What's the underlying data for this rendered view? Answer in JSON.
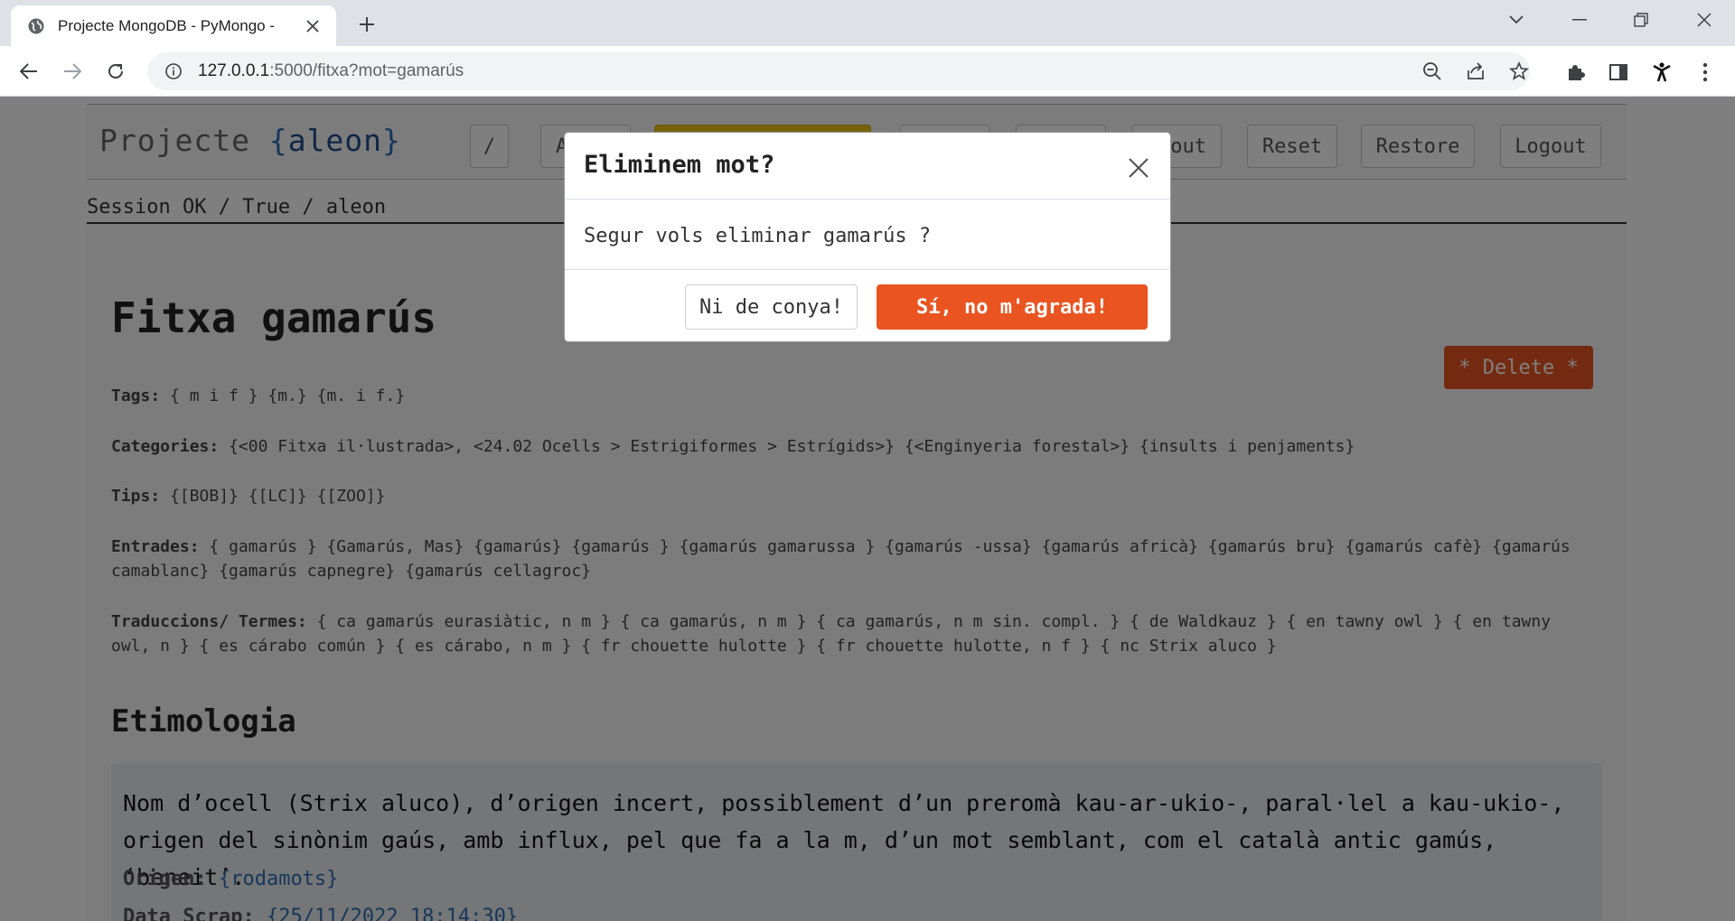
{
  "browser": {
    "tab_title": "Projecte MongoDB - PyMongo -",
    "url_host": "127.0.0.1",
    "url_path": ":5000/fitxa?mot=gamarús"
  },
  "navbar": {
    "brand_prefix": "Projecte ",
    "brand_open": "{",
    "brand_name": "aleon",
    "brand_close": "}",
    "buttons": [
      {
        "label": "/"
      },
      {
        "label": "A"
      },
      {
        "label": ""
      },
      {
        "label": ""
      },
      {
        "label": ""
      },
      {
        "label": "out"
      },
      {
        "label": "Reset"
      },
      {
        "label": "Restore"
      },
      {
        "label": "Logout"
      }
    ]
  },
  "session_text": "Session OK / True / aleon",
  "delete_label": "* Delete *",
  "title": "Fitxa gamarús",
  "fields": {
    "tags_label": "Tags:",
    "tags": [
      "{ m i f }",
      "{m.}",
      "{m. i f.}"
    ],
    "categories_label": "Categories:",
    "categories": [
      "{<00 Fitxa il·lustrada>, <24.02 Ocells > Estrigiformes > Estrígids>}",
      "{<Enginyeria forestal>}",
      "{insults i penjaments}"
    ],
    "tips_label": "Tips:",
    "tips": [
      "{[BOB]}",
      "{[LC]}",
      "{[ZOO]}"
    ],
    "entrades_label": "Entrades:",
    "entrades": "{ gamarús } {Gamarús, Mas} {gamarús} {gamarús } {gamarús  gamarussa } {gamarús -ussa} {gamarús africà} {gamarús bru} {gamarús cafè} {gamarús camablanc} {gamarús capnegre} {gamarús cellagroc}",
    "traduccions_label": "Traduccions/ Termes:",
    "traduccions": "{ ca  gamarús eurasiàtic, n m } { ca  gamarús, n m } { ca  gamarús, n m sin. compl. } { de  Waldkauz } { en  tawny owl } { en  tawny owl, n } { es  cárabo común } { es  cárabo, n m } { fr  chouette hulotte } { fr  chouette hulotte, n f } { nc  Strix aluco }"
  },
  "etimologia": {
    "heading": "Etimologia",
    "text": "Nom d’ocell (Strix aluco), d’origen incert, possiblement d’un preromà kau-ar-ukio-, paral·lel a kau-ukio-, origen del sinònim gaús, amb influx, pel que fa a la m, d’un mot semblant, com el català antic gamús, ‘beneit’.",
    "origen_label": "Origen:",
    "origen_value": "{rodamots}",
    "data_label": "Data Scrap:",
    "data_value": "{25/11/2022 18:14:30}"
  },
  "modal": {
    "title": "Eliminem mot?",
    "body": "Segur vols eliminar gamarús ?",
    "cancel_label": "Ni de conya!",
    "confirm_label": "Sí, no m'agrada!"
  },
  "colors": {
    "accent": "#e95420",
    "active_nav": "#f0c419",
    "brace_blue": "#2c6fb7"
  }
}
